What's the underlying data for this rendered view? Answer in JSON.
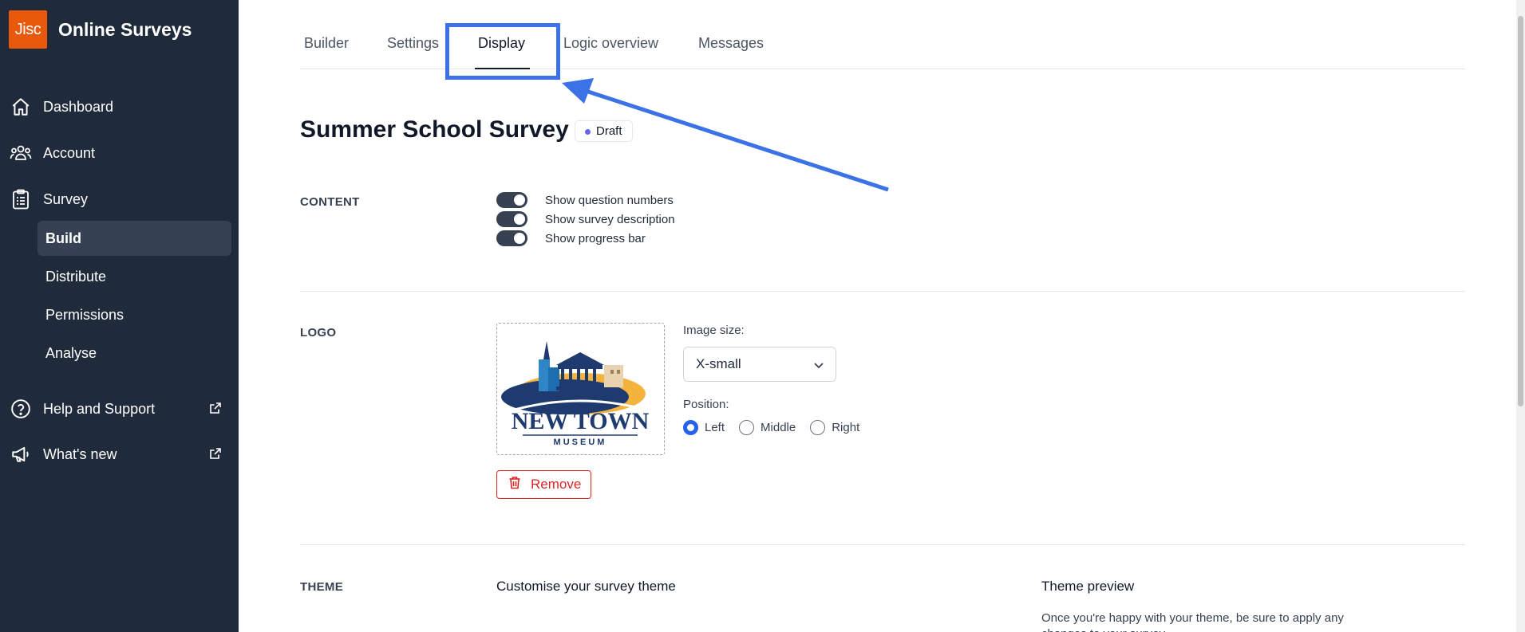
{
  "app": {
    "logo_text": "Jisc",
    "name": "Online Surveys"
  },
  "sidebar": {
    "items": [
      {
        "label": "Dashboard",
        "icon": "home-icon"
      },
      {
        "label": "Account",
        "icon": "users-icon"
      },
      {
        "label": "Survey",
        "icon": "clipboard-icon"
      }
    ],
    "survey_sub": [
      {
        "label": "Build",
        "active": true
      },
      {
        "label": "Distribute",
        "active": false
      },
      {
        "label": "Permissions",
        "active": false
      },
      {
        "label": "Analyse",
        "active": false
      }
    ],
    "external": [
      {
        "label": "Help and Support",
        "icon": "help-circle-icon"
      },
      {
        "label": "What's new",
        "icon": "megaphone-icon"
      }
    ]
  },
  "tabs": [
    {
      "label": "Builder",
      "active": false
    },
    {
      "label": "Settings",
      "active": false
    },
    {
      "label": "Display",
      "active": true
    },
    {
      "label": "Logic overview",
      "active": false
    },
    {
      "label": "Messages",
      "active": false
    }
  ],
  "survey": {
    "title": "Summer School Survey",
    "status": "Draft"
  },
  "content": {
    "section_label": "CONTENT",
    "toggles": [
      {
        "label": "Show question numbers",
        "on": true
      },
      {
        "label": "Show survey description",
        "on": true
      },
      {
        "label": "Show progress bar",
        "on": true
      }
    ]
  },
  "logo": {
    "section_label": "LOGO",
    "image_text": {
      "line1": "NEW TOWN",
      "line2": "MUSEUM"
    },
    "image_size_label": "Image size:",
    "image_size_value": "X-small",
    "position_label": "Position:",
    "positions": [
      {
        "label": "Left",
        "selected": true
      },
      {
        "label": "Middle",
        "selected": false
      },
      {
        "label": "Right",
        "selected": false
      }
    ],
    "remove_label": "Remove"
  },
  "theme": {
    "section_label": "THEME",
    "customise_heading": "Customise your survey theme",
    "preview_heading": "Theme preview",
    "preview_text": "Once you're happy with your theme, be sure to apply any changes to your survey."
  },
  "colors": {
    "sidebar_bg": "#1f2a3b",
    "brand_accent": "#e8590c",
    "highlight": "#3b73e6",
    "danger": "#dc2626",
    "radio_selected": "#2563eb"
  }
}
